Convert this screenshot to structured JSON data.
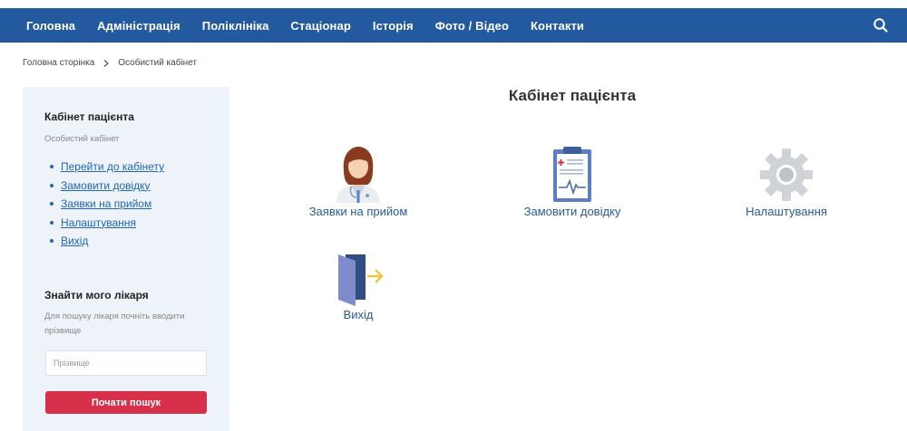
{
  "nav": {
    "items": [
      "Головна",
      "Адміністрація",
      "Поліклініка",
      "Стаціонар",
      "Історія",
      "Фото / Відео",
      "Контакти"
    ],
    "search_icon": "search-icon"
  },
  "breadcrumb": {
    "home": "Головна сторінка",
    "current": "Особистий кабінет"
  },
  "sidebar": {
    "cabinet_title": "Кабінет пацієнта",
    "cabinet_subtitle": "Особистий кабінет",
    "links": [
      "Перейти до кабінету",
      "Замовити довідку",
      "Заявки на прийом",
      "Налаштування",
      "Вихід"
    ],
    "find_title": "Знайти мого лікаря",
    "find_hint_line1": "Для пошуку лікаря почніть вводити",
    "find_hint_line2": "прізвище",
    "search_placeholder": "Прізвище",
    "search_button": "Почати пошук"
  },
  "main": {
    "title": "Кабінет пацієнта",
    "tiles": [
      {
        "label": "Заявки на прийом",
        "icon": "doctor-icon"
      },
      {
        "label": "Замовити довідку",
        "icon": "clipboard-icon"
      },
      {
        "label": "Налаштування",
        "icon": "gear-icon"
      },
      {
        "label": "Вихід",
        "icon": "exit-door-icon"
      }
    ]
  },
  "colors": {
    "nav_bg": "#23599f",
    "sidebar_bg": "#eef2f9",
    "link": "#1f66b5",
    "button": "#d6304a"
  }
}
